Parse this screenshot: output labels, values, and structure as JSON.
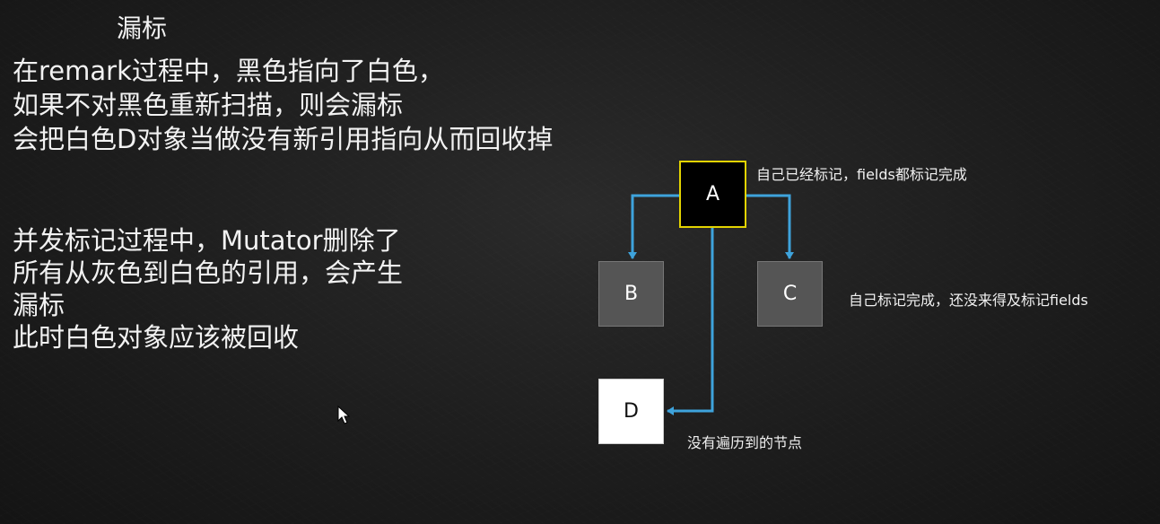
{
  "title": "漏标",
  "paragraph1": [
    "在remark过程中，黑色指向了白色，",
    "如果不对黑色重新扫描，则会漏标",
    "会把白色D对象当做没有新引用指向从而回收掉"
  ],
  "paragraph2": [
    "并发标记过程中，Mutator删除了",
    "所有从灰色到白色的引用，会产生",
    "漏标",
    "此时白色对象应该被回收"
  ],
  "diagram": {
    "nodes": {
      "a": {
        "label": "A",
        "fill": "#000000",
        "border": "#e3d400"
      },
      "b": {
        "label": "B",
        "fill": "#555555"
      },
      "c": {
        "label": "C",
        "fill": "#555555"
      },
      "d": {
        "label": "D",
        "fill": "#ffffff"
      }
    },
    "notes": {
      "a": "自己已经标记，fields都标记完成",
      "c": "自己标记完成，还没来得及标记fields",
      "d": "没有遍历到的节点"
    },
    "edge_color": "#3ea3dc"
  },
  "colors": {
    "background": "#1d1d1d",
    "text": "#f2f2f2"
  }
}
